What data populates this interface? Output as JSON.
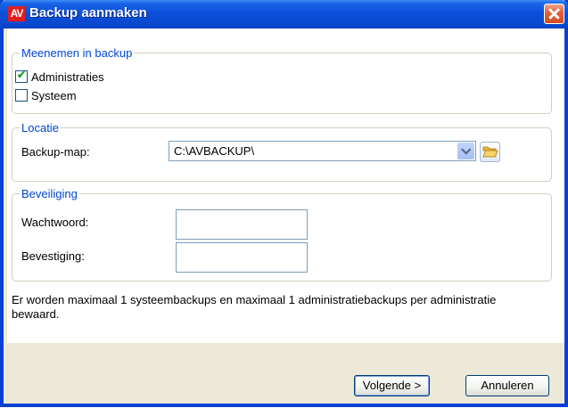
{
  "window": {
    "title": "Backup aanmaken",
    "app_icon": "AV"
  },
  "groups": {
    "include": {
      "legend": "Meenemen in backup",
      "options": [
        {
          "label": "Administraties",
          "checked": true
        },
        {
          "label": "Systeem",
          "checked": false
        }
      ]
    },
    "location": {
      "legend": "Locatie",
      "backup_folder_label": "Backup-map:",
      "backup_folder_value": "C:\\AVBACKUP\\"
    },
    "security": {
      "legend": "Beveiliging",
      "password_label": "Wachtwoord:",
      "password_value": "",
      "confirm_label": "Bevestiging:",
      "confirm_value": ""
    }
  },
  "info_text": "Er worden maximaal 1 systeembackups en maximaal 1 administratiebackups per administratie bewaard.",
  "buttons": {
    "next": "Volgende >",
    "cancel": "Annuleren"
  },
  "colors": {
    "titlebar": "#0a49d0",
    "legend_text": "#0046d5",
    "close_button": "#d54a1f",
    "dialog_background": "#ece9d8"
  }
}
